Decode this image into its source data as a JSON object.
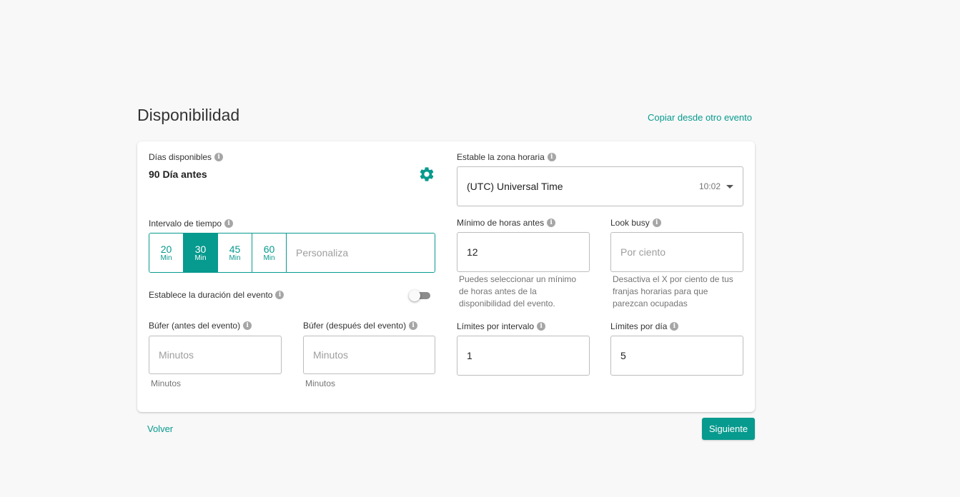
{
  "header": {
    "title": "Disponibilidad",
    "copy_link": "Copiar desde otro evento"
  },
  "days": {
    "label": "Días disponibles",
    "value": "90 Día antes",
    "icon": "gear-icon"
  },
  "timezone": {
    "label": "Estable la zona horaria",
    "value": "(UTC) Universal Time",
    "time": "10:02"
  },
  "interval": {
    "label": "Intervalo de tiempo",
    "options": [
      {
        "num": "20",
        "unit": "Min",
        "selected": false
      },
      {
        "num": "30",
        "unit": "Min",
        "selected": true
      },
      {
        "num": "45",
        "unit": "Min",
        "selected": false
      },
      {
        "num": "60",
        "unit": "Min",
        "selected": false
      }
    ],
    "custom_placeholder": "Personaliza"
  },
  "duration": {
    "label": "Establece la duración del evento",
    "enabled": false
  },
  "buffer_before": {
    "label": "Búfer (antes del evento)",
    "placeholder": "Minutos",
    "value": "",
    "helper": "Minutos"
  },
  "buffer_after": {
    "label": "Búfer (después del evento)",
    "placeholder": "Minutos",
    "value": "",
    "helper": "Minutos"
  },
  "min_hours": {
    "label": "Mínimo de horas antes",
    "value": "12",
    "helper": "Puedes seleccionar un mínimo de horas antes de la disponibilidad del evento."
  },
  "look_busy": {
    "label": "Look busy",
    "placeholder": "Por ciento",
    "value": "",
    "helper": "Desactiva el X por ciento de tus franjas horarias para que parezcan ocupadas"
  },
  "limit_interval": {
    "label": "Límites por intervalo",
    "value": "1"
  },
  "limit_day": {
    "label": "Límites por día",
    "value": "5"
  },
  "footer": {
    "back_label": "Volver",
    "next_label": "Siguiente"
  },
  "colors": {
    "accent": "#079a8e",
    "background": "#f8f8f8",
    "info_icon": "#a6a6a6"
  }
}
